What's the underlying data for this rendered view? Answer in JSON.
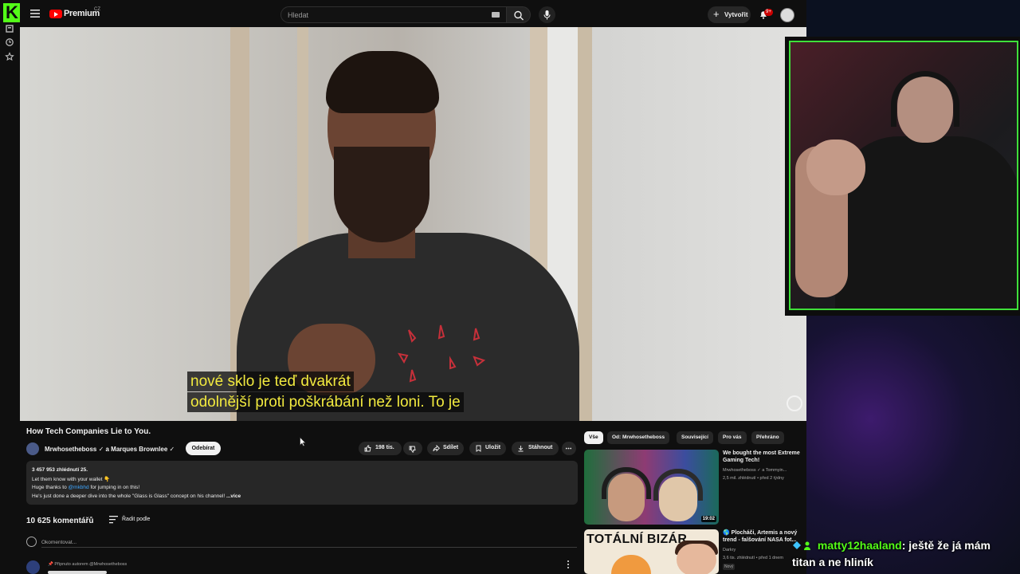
{
  "topbar": {
    "brand": "Premium",
    "region": "CZ",
    "search_placeholder": "Hledat",
    "create_label": "Vytvořit",
    "notifications_badge": "9+"
  },
  "player": {
    "subtitle_line1": "nové sklo je teď dvakrát",
    "subtitle_line2": "odolnější proti poškrábání než loni.  To je"
  },
  "video": {
    "title": "How Tech Companies Lie to You.",
    "channel": "Mrwhosetheboss ✓ a Marques Brownlee ✓",
    "subscribe_label": "Odebírat",
    "like_count": "198 tis.",
    "share_label": "Sdílet",
    "save_label": "Uložit",
    "download_label": "Stáhnout"
  },
  "description": {
    "stats": "3 457 953 zhlédnutí  25.",
    "line1": "Let them know with your wallet 👇",
    "line2_pre": "Huge thanks to ",
    "line2_link": "@mkbhd",
    "line2_post": " for jumping in on this!",
    "line3": "He's just done a deeper dive into the whole \"Glass is Glass\" concept on his channel!",
    "more": "...více"
  },
  "comments": {
    "count": "10 625 komentářů",
    "sort_label": "Řadit podle",
    "input_placeholder": "Okomentovat...",
    "pinned": "📌 Připnuto autorem @Mrwhosetheboss"
  },
  "filters": [
    "Vše",
    "Od: Mrwhosetheboss",
    "Související",
    "Pro vás",
    "Přehráno"
  ],
  "recommendations": [
    {
      "title": "We bought the most Extreme Gaming Tech!",
      "channel": "Mrwhosetheboss ✓ a Tommyin...",
      "meta": "2,5 mil. zhlédnutí • před 2 týdny",
      "duration": "19:02"
    },
    {
      "title": "🌎 Plocháči, Artemis a nový trend - falšování NASA fot...",
      "channel": "Darkry",
      "meta": "3,6 tis. zhlédnutí • před 1 dnem",
      "badge": "Nový",
      "thumb_text": "TOTÁLNÍ BIZÁR"
    }
  ],
  "chat": {
    "username": "matty12haaland",
    "message": ": ještě že já mám titan a ne hliník"
  },
  "colors": {
    "kick_green": "#53fc18",
    "youtube_red": "#ff0000",
    "subtitle_yellow": "#f2ea3f",
    "webcam_border": "#3fe03a"
  }
}
